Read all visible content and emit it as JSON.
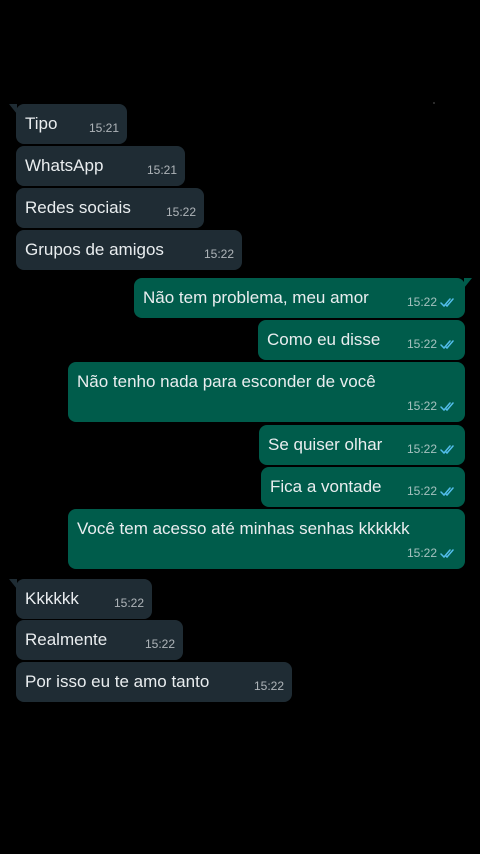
{
  "messages": [
    {
      "text": "Tipo",
      "time": "15:21",
      "dir": "in"
    },
    {
      "text": "WhatsApp",
      "time": "15:21",
      "dir": "in"
    },
    {
      "text": "Redes sociais",
      "time": "15:22",
      "dir": "in"
    },
    {
      "text": "Grupos de amigos",
      "time": "15:22",
      "dir": "in"
    },
    {
      "text": "Não tem problema, meu amor",
      "time": "15:22",
      "dir": "out",
      "read": true
    },
    {
      "text": "Como eu disse",
      "time": "15:22",
      "dir": "out",
      "read": true
    },
    {
      "text": "Não tenho nada para esconder de você",
      "time": "15:22",
      "dir": "out",
      "read": true
    },
    {
      "text": "Se quiser olhar",
      "time": "15:22",
      "dir": "out",
      "read": true
    },
    {
      "text": "Fica a vontade",
      "time": "15:22",
      "dir": "out",
      "read": true
    },
    {
      "text": "Você tem acesso até minhas senhas kkkkkk",
      "time": "15:22",
      "dir": "out",
      "read": true
    },
    {
      "text": "Kkkkkk",
      "time": "15:22",
      "dir": "in"
    },
    {
      "text": "Realmente",
      "time": "15:22",
      "dir": "in"
    },
    {
      "text": "Por isso eu te amo tanto",
      "time": "15:22",
      "dir": "in"
    }
  ],
  "colors": {
    "background": "#000000",
    "incoming_bubble": "#1f2c34",
    "outgoing_bubble": "#005c4b",
    "read_ticks": "#53bdeb"
  },
  "icons": {
    "read_receipt": "double-check-icon"
  }
}
